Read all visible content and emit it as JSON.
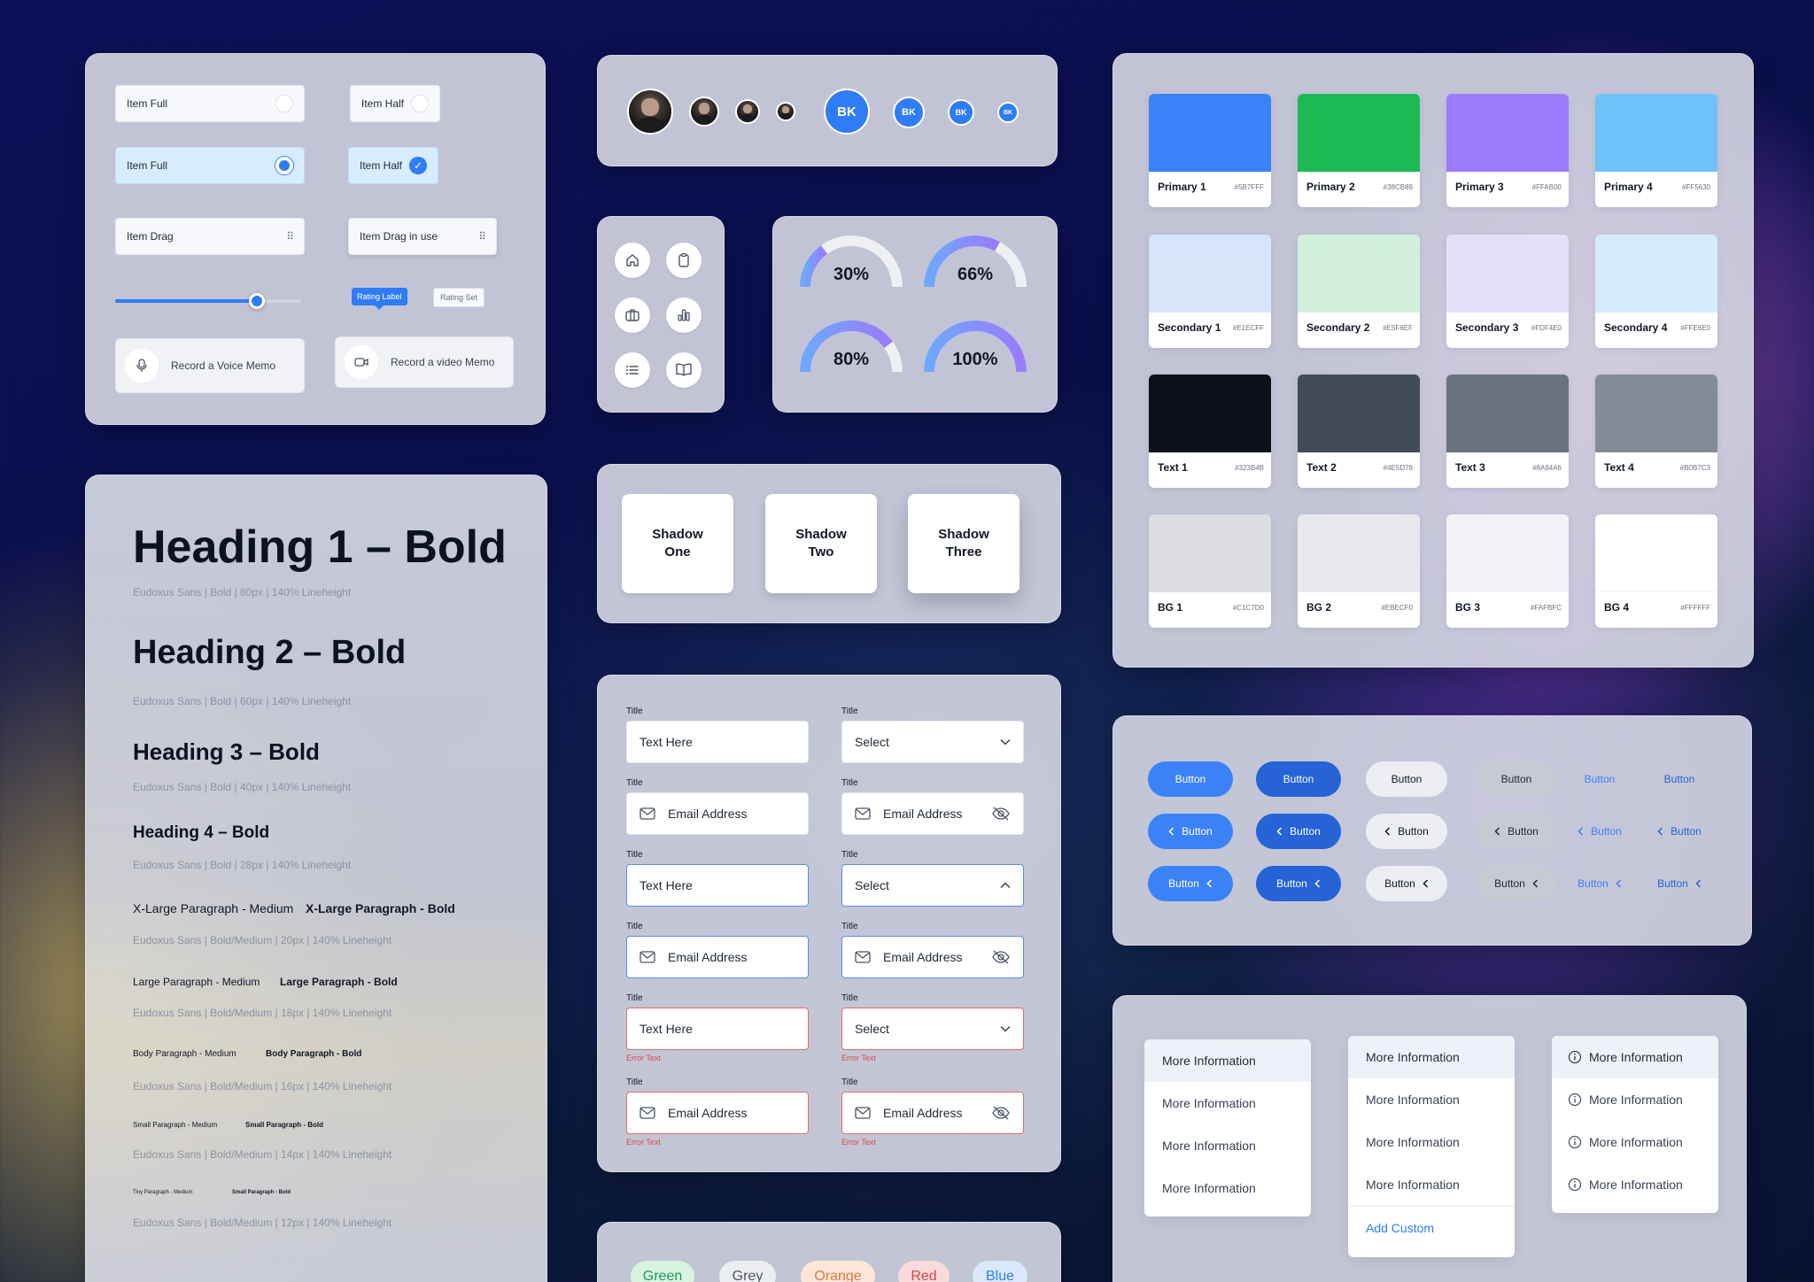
{
  "controls": {
    "item_full_1": "Item Full",
    "item_half_1": "Item Half",
    "item_full_2": "Item Full",
    "item_half_2": "Item Half",
    "item_drag": "Item Drag",
    "item_drag_in_use": "Item Drag in use",
    "slider_value": 0.78,
    "rating_label": "Rating Label",
    "rating_set": "Rating Set",
    "voice_memo": "Record a Voice Memo",
    "video_memo": "Record a video Memo"
  },
  "avatars": {
    "initials": "BK"
  },
  "gauges": [
    {
      "label": "30%",
      "value": 0.3
    },
    {
      "label": "66%",
      "value": 0.66
    },
    {
      "label": "80%",
      "value": 0.8
    },
    {
      "label": "100%",
      "value": 1.0
    }
  ],
  "shadows": {
    "one": "Shadow One",
    "two": "Shadow Two",
    "three": "Shadow Three"
  },
  "typography": {
    "h1": "Heading 1 –  Bold",
    "h1_meta": "Eudoxus Sans | Bold | 80px | 140% Lineheight",
    "h2": "Heading 2 –  Bold",
    "h2_meta": "Eudoxus Sans | Bold | 60px | 140% Lineheight",
    "h3": "Heading 3 –  Bold",
    "h3_meta": "Eudoxus Sans | Bold | 40px |   140% Lineheight",
    "h4": "Heading 4 – Bold",
    "h4_meta": "Eudoxus Sans | Bold | 28px | 140% Lineheight",
    "xl_medium": "X-Large Paragraph - Medium",
    "xl_bold": "X-Large Paragraph - Bold",
    "xl_meta": "Eudoxus Sans | Bold/Medium | 20px | 140% Lineheight",
    "l_medium": "Large Paragraph - Medium",
    "l_bold": "Large Paragraph - Bold",
    "l_meta": "Eudoxus Sans | Bold/Medium | 18px | 140% Lineheight",
    "b_medium": "Body Paragraph - Medium",
    "b_bold": "Body Paragraph - Bold",
    "b_meta": "Eudoxus Sans | Bold/Medium | 16px | 140% Lineheight",
    "s_medium": "Small Paragraph - Medium",
    "s_bold": "Small Paragraph - Bold",
    "s_meta": "Eudoxus Sans | Bold/Medium | 14px | 140% Lineheight",
    "t_medium": "Tiny Paragraph - Medium",
    "t_bold": "Small Paragraph - Bold",
    "t_meta": "Eudoxus Sans | Bold/Medium | 12px | 140% Lineheight"
  },
  "swatches": [
    {
      "label": "Primary 1",
      "hex": "#5B7FFF",
      "color": "#3b82f6"
    },
    {
      "label": "Primary 2",
      "hex": "#38CB89",
      "color": "#1db954"
    },
    {
      "label": "Primary 3",
      "hex": "#FFAB00",
      "color": "#9b7bfb"
    },
    {
      "label": "Primary 4",
      "hex": "#FF5630",
      "color": "#6ec1fb"
    },
    {
      "label": "Secondary 1",
      "hex": "#E1ECFF",
      "color": "#d6e4fc"
    },
    {
      "label": "Secondary 2",
      "hex": "#E5F6EF",
      "color": "#d2f0dc"
    },
    {
      "label": "Secondary 3",
      "hex": "#FDF4E0",
      "color": "#e6e0fb"
    },
    {
      "label": "Secondary 4",
      "hex": "#FFE6E0",
      "color": "#d4ebfb"
    },
    {
      "label": "Text 1",
      "hex": "#323B4B",
      "color": "#0c1118"
    },
    {
      "label": "Text 2",
      "hex": "#4E5D78",
      "color": "#414b5a"
    },
    {
      "label": "Text 3",
      "hex": "#8A94A6",
      "color": "#69737f"
    },
    {
      "label": "Text 4",
      "hex": "#B0B7C3",
      "color": "#838b96"
    },
    {
      "label": "BG 1",
      "hex": "#C1C7D0",
      "color": "#dcdde0"
    },
    {
      "label": "BG 2",
      "hex": "#EBECF0",
      "color": "#e8e9ee"
    },
    {
      "label": "BG 3",
      "hex": "#FAFBFC",
      "color": "#f1f2f5"
    },
    {
      "label": "BG 4",
      "hex": "#FFFFFF",
      "color": "#ffffff"
    }
  ],
  "inputs": {
    "title": "Title",
    "text_here": "Text Here",
    "select": "Select",
    "email": "Email Address",
    "error": "Error Text"
  },
  "buttons": {
    "label": "Button"
  },
  "menus": {
    "item": "More Information",
    "add_custom": "Add Custom"
  },
  "chips": [
    "Green",
    "Grey",
    "Orange",
    "Red",
    "Blue"
  ],
  "colors": {
    "accent": "#2F7CF6",
    "error": "#E04848"
  }
}
